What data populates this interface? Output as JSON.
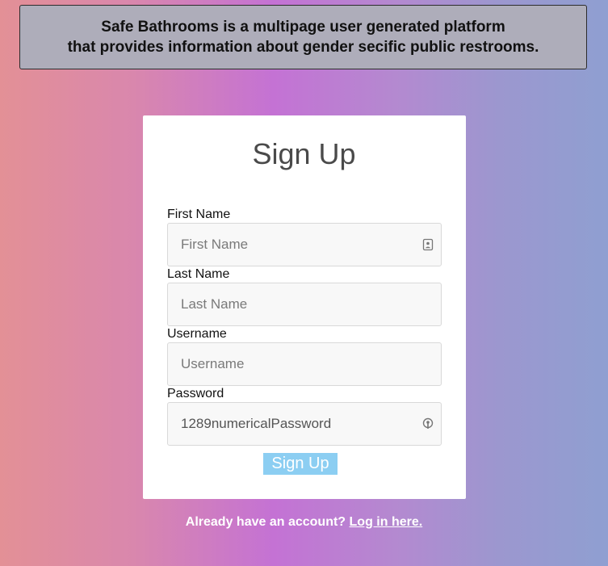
{
  "banner": {
    "line1": "Safe Bathrooms is a multipage user generated platform",
    "line2": "that provides information about gender secific public restrooms."
  },
  "form": {
    "title": "Sign Up",
    "first_name": {
      "label": "First Name",
      "placeholder": "First Name",
      "value": "",
      "icon": "contact-card-icon"
    },
    "last_name": {
      "label": "Last Name",
      "placeholder": "Last Name",
      "value": ""
    },
    "username": {
      "label": "Username",
      "placeholder": "Username",
      "value": ""
    },
    "password": {
      "label": "Password",
      "placeholder": "Password",
      "value": "1289numericalPassword",
      "icon": "password-key-icon"
    },
    "submit_label": "Sign Up"
  },
  "footer": {
    "prompt": "Already have an account?",
    "link_text": "Log in here."
  },
  "colors": {
    "submit_bg": "#8ccef2",
    "banner_bg": "#aeadba",
    "gradient": [
      "#e39096",
      "#c472d4",
      "#8f9fd1"
    ]
  }
}
